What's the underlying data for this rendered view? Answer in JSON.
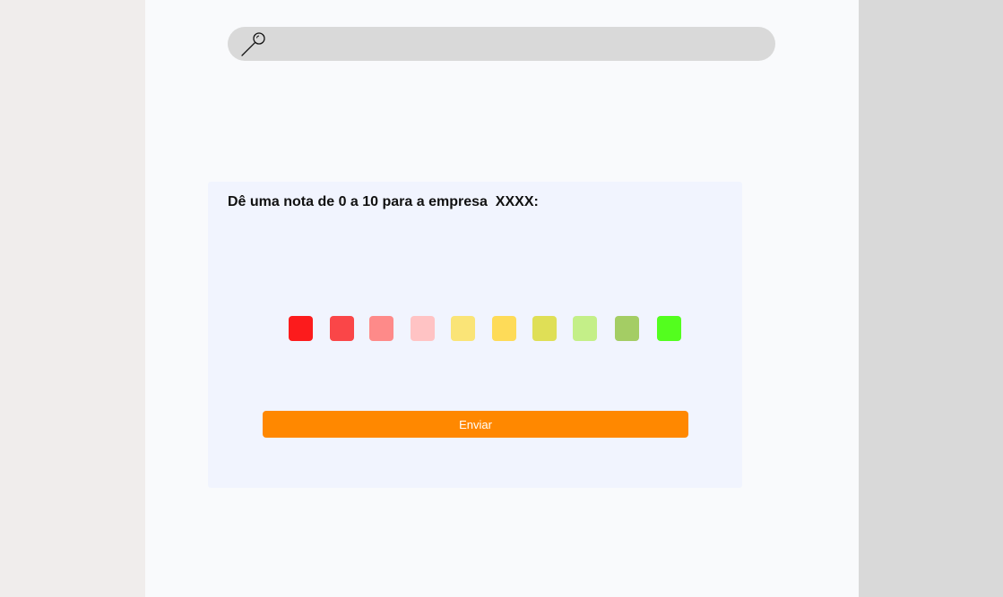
{
  "search": {
    "value": "",
    "placeholder": ""
  },
  "survey": {
    "question": "Dê uma nota de 0 a 10 para a empresa  XXXX:",
    "rating_colors": [
      "#fc1b1c",
      "#fa4648",
      "#fe8a89",
      "#ffc3c4",
      "#fae477",
      "#fedb58",
      "#dfdf56",
      "#c4ef88",
      "#a4cd64",
      "#53fe1e"
    ],
    "submit_label": "Enviar"
  },
  "colors": {
    "accent": "#ff8800",
    "card_background": "#f1f4fe",
    "search_background": "#d9d9d9"
  }
}
